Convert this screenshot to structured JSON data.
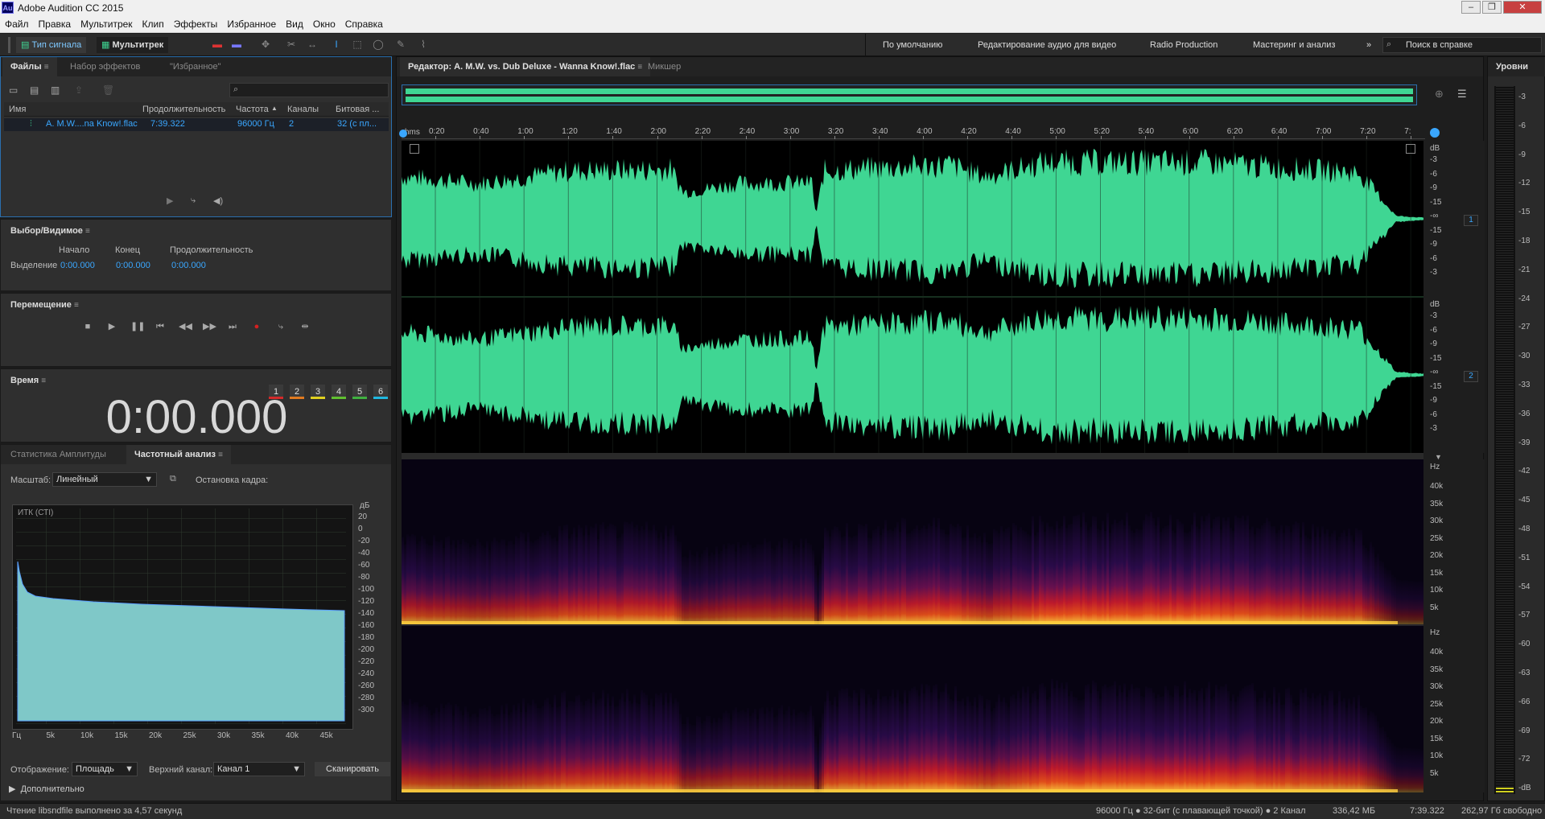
{
  "app": {
    "title": "Adobe Audition CC 2015",
    "logo": "Au"
  },
  "menu": [
    "Файл",
    "Правка",
    "Мультитрек",
    "Клип",
    "Эффекты",
    "Избранное",
    "Вид",
    "Окно",
    "Справка"
  ],
  "toolbar": {
    "waveform_label": "Тип сигнала",
    "multitrack_label": "Мультитрек",
    "workspaces": [
      "По умолчанию",
      "Редактирование аудио для видео",
      "Radio Production",
      "Мастеринг и анализ"
    ],
    "more_glyph": "»",
    "search_placeholder": "Поиск в справке"
  },
  "files_panel": {
    "tabs": [
      "Файлы",
      "Набор эффектов",
      "\"Избранное\""
    ],
    "columns": [
      "Имя",
      "Продолжительность",
      "Частота",
      "Каналы",
      "Битовая ..."
    ],
    "rows": [
      {
        "name": "A. M.W....na Know!.flac",
        "duration": "7:39.322",
        "rate": "96000 Гц",
        "channels": "2",
        "bitdepth": "32 (с пл..."
      }
    ]
  },
  "selection_panel": {
    "title": "Выбор/Видимое",
    "col_start": "Начало",
    "col_end": "Конец",
    "col_duration": "Продолжительность",
    "row_label": "Выделение",
    "start": "0:00.000",
    "end": "0:00.000",
    "duration": "0:00.000"
  },
  "transport_panel": {
    "title": "Перемещение"
  },
  "time_panel": {
    "title": "Время",
    "display": "0:00.000"
  },
  "analysis_panel": {
    "tabs": [
      "Статистика Амплитуды",
      "Частотный анализ"
    ],
    "scale_label": "Масштаб:",
    "scale_value": "Линейный",
    "hold_label": "Остановка кадра:",
    "hold_buttons": [
      "1",
      "2",
      "3",
      "4",
      "5",
      "6"
    ],
    "hold_colors": [
      "#d42a2a",
      "#e07a20",
      "#e0d020",
      "#60c030",
      "#40b040",
      "#20b8e0"
    ],
    "graph_title": "ИТК (СТI)",
    "db_unit": "дБ",
    "db_ticks": [
      "20",
      "0",
      "-20",
      "-40",
      "-60",
      "-80",
      "-100",
      "-120",
      "-140",
      "-160",
      "-180",
      "-200",
      "-220",
      "-240",
      "-260",
      "-280",
      "-300"
    ],
    "freq_ticks": [
      "Гц",
      "5k",
      "10k",
      "15k",
      "20k",
      "25k",
      "30k",
      "35k",
      "40k",
      "45k"
    ],
    "display_label": "Отображение:",
    "display_value": "Площадь",
    "channel_label": "Верхний канал:",
    "channel_value": "Канал 1",
    "scan_label": "Сканировать",
    "advanced_label": "Дополнительно"
  },
  "editor": {
    "tab_label": "Редактор: A. M.W. vs. Dub Deluxe - Wanna Know!.flac",
    "mixer_label": "Микшер",
    "ruler_unit": "hms",
    "time_ticks": [
      "0:20",
      "0:40",
      "1:00",
      "1:20",
      "1:40",
      "2:00",
      "2:20",
      "2:40",
      "3:00",
      "3:20",
      "3:40",
      "4:00",
      "4:20",
      "4:40",
      "5:00",
      "5:20",
      "5:40",
      "6:00",
      "6:20",
      "6:40",
      "7:00",
      "7:20",
      "7:"
    ],
    "wave_db_unit": "dB",
    "wave_db_ticks": [
      "-3",
      "-6",
      "-9",
      "-15",
      "-∞",
      "-15",
      "-9",
      "-6",
      "-3"
    ],
    "channels": [
      "1",
      "2"
    ],
    "spec_unit": "Hz",
    "spec_ticks": [
      "40k",
      "35k",
      "30k",
      "25k",
      "20k",
      "15k",
      "10k",
      "5k"
    ],
    "wave_color": "#3fd693"
  },
  "levels": {
    "title": "Уровни",
    "ticks": [
      "-3",
      "-6",
      "-9",
      "-12",
      "-15",
      "-18",
      "-21",
      "-24",
      "-27",
      "-30",
      "-33",
      "-36",
      "-39",
      "-42",
      "-45",
      "-48",
      "-51",
      "-54",
      "-57",
      "-60",
      "-63",
      "-66",
      "-69",
      "-72",
      "-dB"
    ]
  },
  "status": {
    "left": "Чтение libsndfile выполнено за 4,57 секунд",
    "format": "96000 Гц ● 32-бит (с плавающей точкой) ● 2 Канал",
    "size": "336,42 МБ",
    "duration": "7:39.322",
    "free": "262,97 Гб свободно"
  }
}
